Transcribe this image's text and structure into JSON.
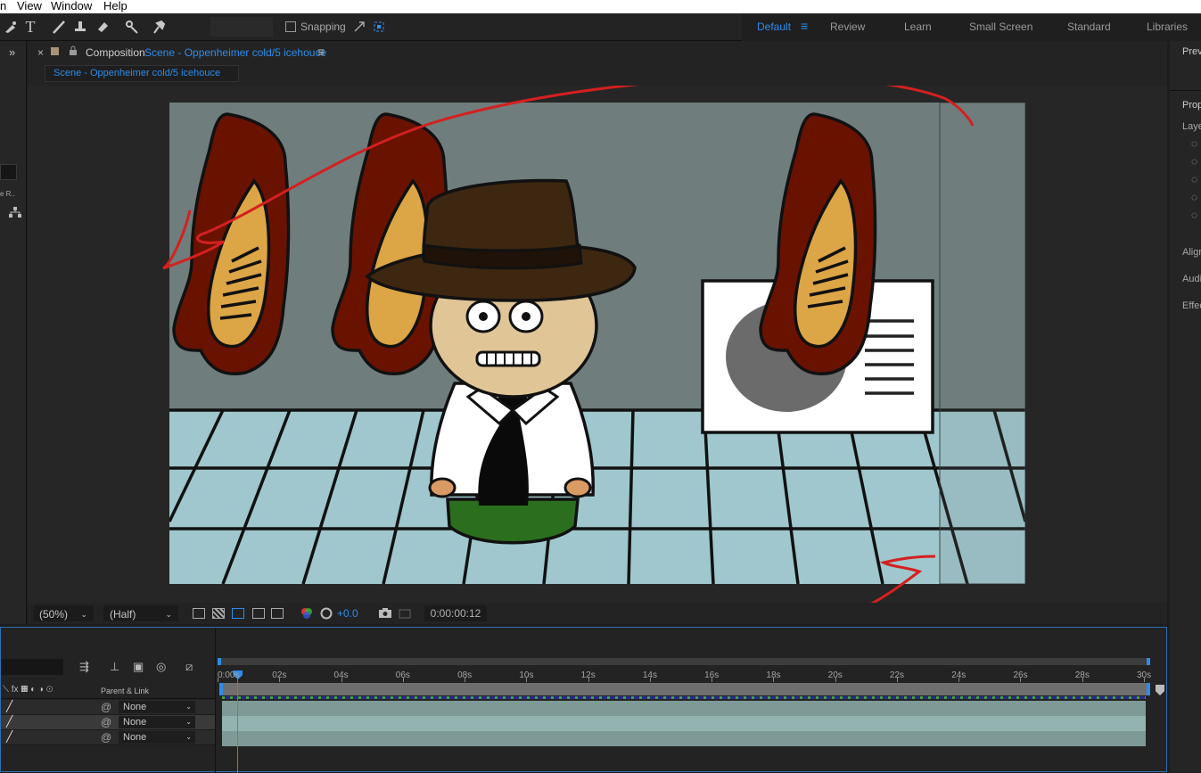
{
  "menu": {
    "item_partial": "n",
    "view": "View",
    "window": "Window",
    "help": "Help"
  },
  "toolbar": {
    "snapping_label": "Snapping",
    "workspaces": [
      {
        "label": "Default",
        "active": true
      },
      {
        "label": "Review"
      },
      {
        "label": "Learn"
      },
      {
        "label": "Small Screen"
      },
      {
        "label": "Standard"
      },
      {
        "label": "Libraries"
      }
    ]
  },
  "composition": {
    "panel_prefix": "Composition",
    "panel_name": "Scene - Oppenheimer cold/5 icehouce",
    "tab_label": "Scene - Oppenheimer cold/5 icehouce"
  },
  "viewer_controls": {
    "zoom": "(50%)",
    "resolution": "(Half)",
    "exposure": "+0.0",
    "timecode": "0:00:00:12"
  },
  "right_panel": {
    "preview": "Previ",
    "properties": "Prop",
    "layer": "Laye",
    "align": "Align",
    "audio": "Audi",
    "effects": "Effec"
  },
  "left_panel": {
    "label": "e R.."
  },
  "timeline": {
    "parent_header": "Parent & Link",
    "ruler": [
      "0:00s",
      "02s",
      "04s",
      "06s",
      "08s",
      "10s",
      "12s",
      "14s",
      "16s",
      "18s",
      "20s",
      "22s",
      "24s",
      "26s",
      "28s",
      "30s"
    ],
    "current_time_fraction": 0.01,
    "layers": [
      {
        "parent": "None"
      },
      {
        "parent": "None"
      },
      {
        "parent": "None"
      }
    ]
  },
  "colors": {
    "accent": "#2d8ceb",
    "annotation": "#d4201f",
    "wall": "#6f7d7d",
    "floor": "#9fc7cd"
  }
}
